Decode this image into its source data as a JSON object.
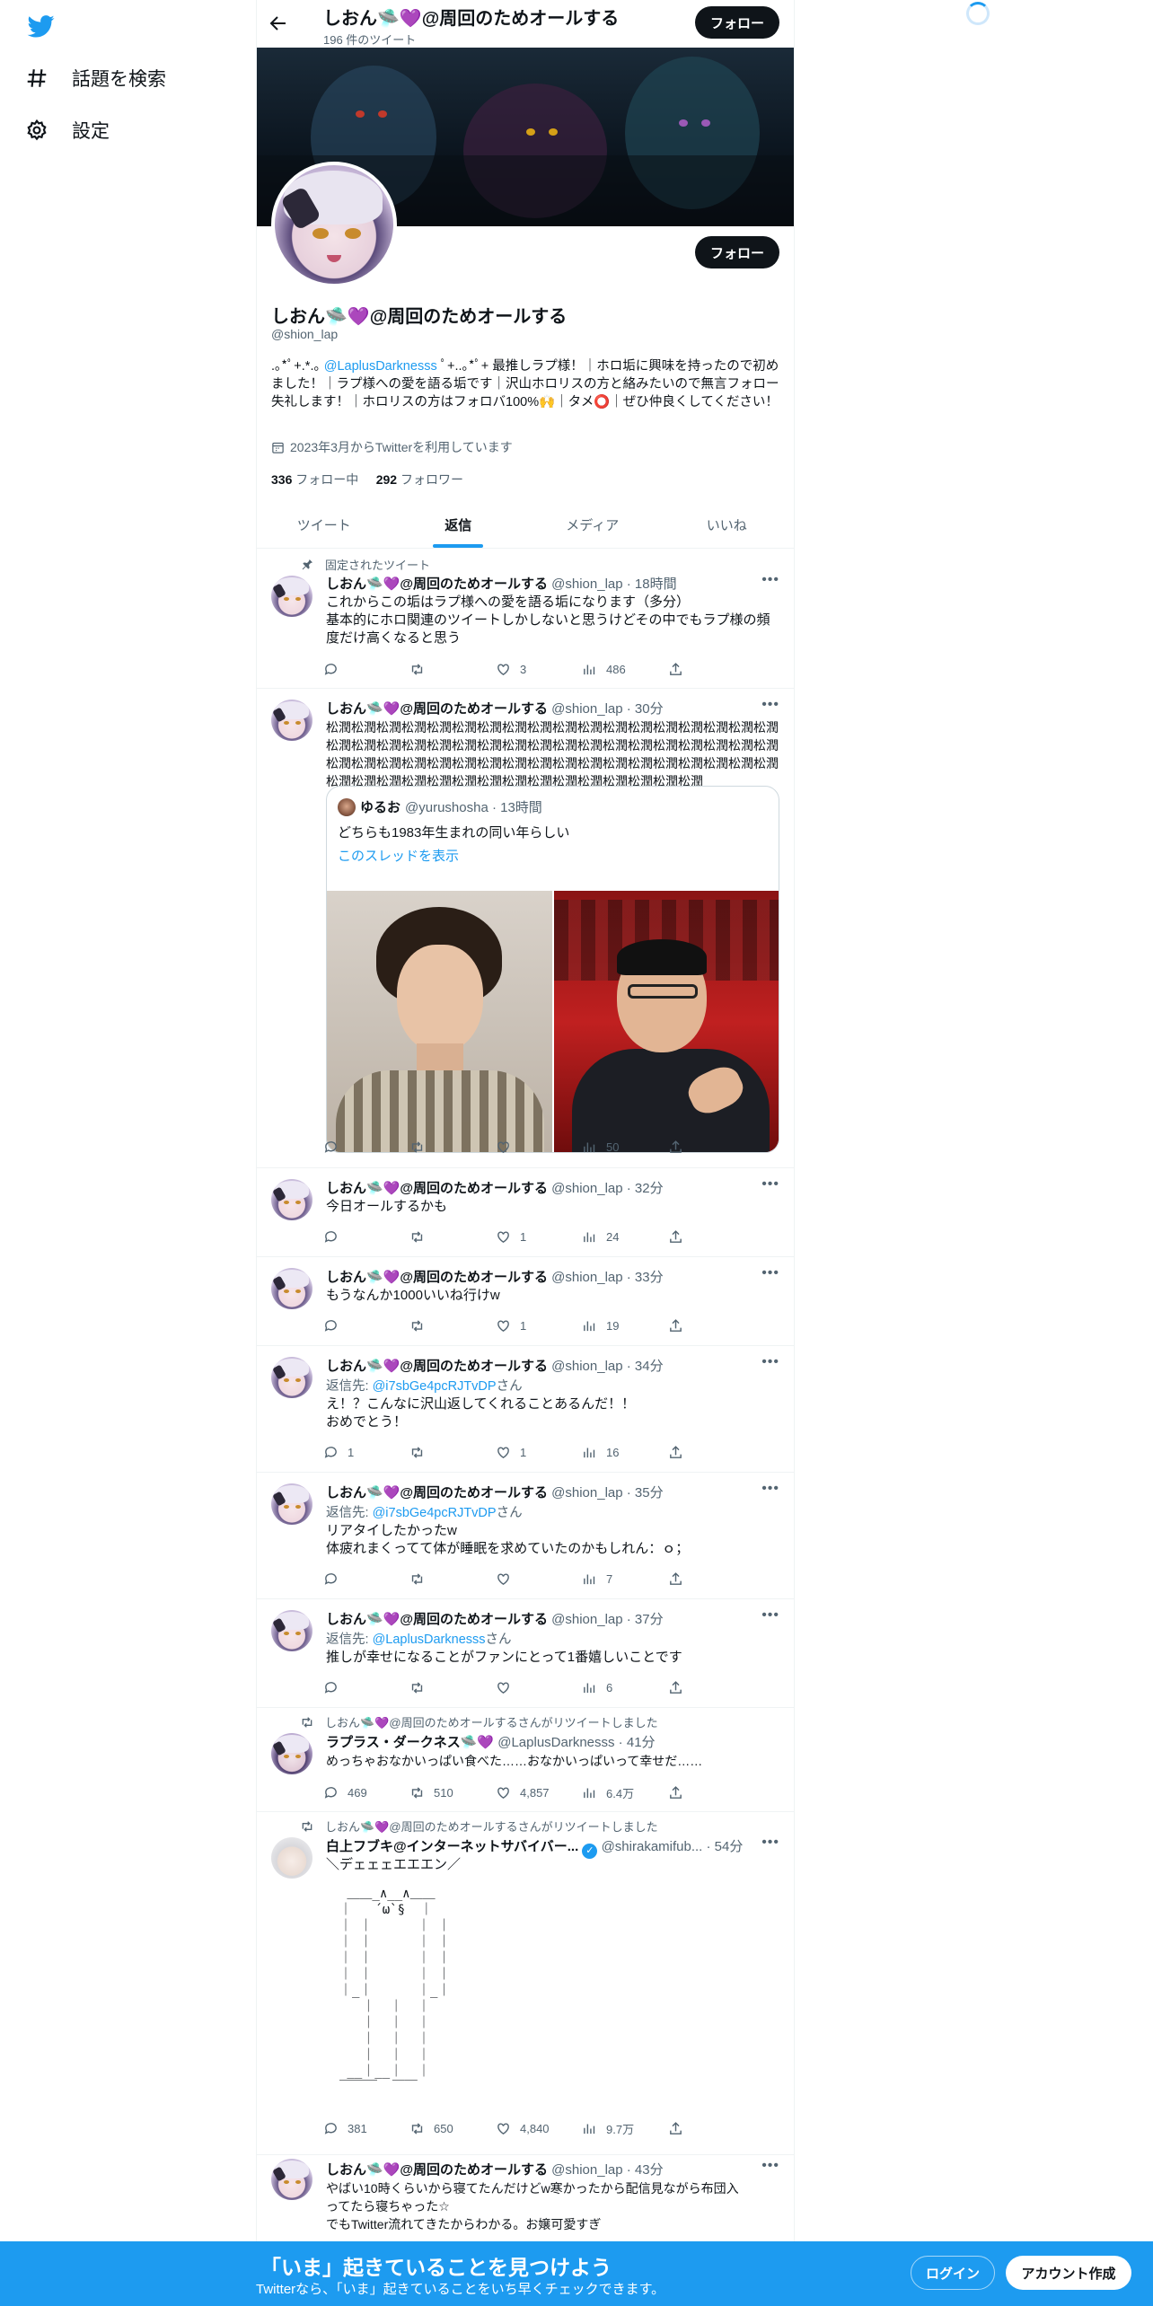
{
  "nav": {
    "logo": "twitter-bird-icon",
    "items": [
      {
        "label": "話題を検索",
        "icon": "hashtag-icon"
      },
      {
        "label": "設定",
        "icon": "gear-icon"
      }
    ]
  },
  "header": {
    "name": "しおん🛸💜@周回のためオールする",
    "tweet_count": "196 件のツイート",
    "follow_label": "フォロー"
  },
  "profile": {
    "name": "しおん🛸💜@周回のためオールする",
    "handle": "@shion_lap",
    "follow_label": "フォロー",
    "bio_pre": ".｡*ﾟ+.*.｡ ",
    "bio_mention": "@LaplusDarknesss",
    "bio_rest": " ﾟ+..｡*ﾟ+ 最推しラプ様！｜ホロ垢に興味を持ったので初めました！｜ラプ様への愛を語る垢です｜沢山ホロリスの方と絡みたいので無言フォロー失礼します！｜ホロリスの方はフォロバ100%🙌｜タメ⭕️｜ぜひ仲良くしてください！",
    "joined": "2023年3月からTwitterを利用しています",
    "following_count": "336",
    "following_label": "フォロー中",
    "followers_count": "292",
    "followers_label": "フォロワー"
  },
  "tabs": [
    {
      "label": "ツイート",
      "active": false
    },
    {
      "label": "返信",
      "active": true
    },
    {
      "label": "メディア",
      "active": false
    },
    {
      "label": "いいね",
      "active": false
    }
  ],
  "tweets": [
    {
      "context": "固定されたツイート",
      "name": "しおん🛸💜@周回のためオールする",
      "handle_time": "@shion_lap · 18時間",
      "text_lines": [
        "これからこの垢はラプ様への愛を語る垢になります（多分）",
        "基本的にホロ関連のツイートしかしないと思うけどその中でもラプ様の頻",
        "度だけ高くなると思う"
      ],
      "replies": "",
      "retweets": "",
      "likes": "3",
      "views": "486"
    },
    {
      "name": "しおん🛸💜@周回のためオールする",
      "handle_time": "@shion_lap · 30分",
      "text_lines": [
        "松潤松潤松潤松潤松潤松潤松潤松潤松潤松潤松潤松潤松潤松潤松潤松潤松潤松潤",
        "松潤松潤松潤松潤松潤松潤松潤松潤松潤松潤松潤松潤松潤松潤松潤松潤松潤松潤",
        "松潤松潤松潤松潤松潤松潤松潤松潤松潤松潤松潤松潤松潤松潤松潤松潤松潤松潤",
        "松潤松潤松潤松潤松潤松潤松潤松潤松潤松潤松潤松潤松潤松潤松潤"
      ],
      "quote": {
        "name": "ゆるお",
        "handle_time": "@yurushosha · 13時間",
        "text": "どちらも1983年生まれの同い年らしい",
        "thread_link": "このスレッドを表示"
      },
      "replies": "",
      "retweets": "",
      "likes": "",
      "views": "50"
    },
    {
      "name": "しおん🛸💜@周回のためオールする",
      "handle_time": "@shion_lap · 32分",
      "text_lines": [
        "今日オールするかも"
      ],
      "replies": "",
      "retweets": "",
      "likes": "1",
      "views": "24"
    },
    {
      "name": "しおん🛸💜@周回のためオールする",
      "handle_time": "@shion_lap · 33分",
      "text_lines": [
        "もうなんか1000いいね行けw"
      ],
      "replies": "",
      "retweets": "",
      "likes": "1",
      "views": "19"
    },
    {
      "name": "しおん🛸💜@周回のためオールする",
      "handle_time": "@shion_lap · 34分",
      "reply_prefix": "返信先: ",
      "reply_to": "@i7sbGe4pcRJTvDP",
      "reply_suffix": "さん",
      "text_lines": [
        "え！？こんなに沢山返してくれることあるんだ！！",
        "おめでとう！"
      ],
      "replies": "1",
      "retweets": "",
      "likes": "1",
      "views": "16"
    },
    {
      "name": "しおん🛸💜@周回のためオールする",
      "handle_time": "@shion_lap · 35分",
      "reply_prefix": "返信先: ",
      "reply_to": "@i7sbGe4pcRJTvDP",
      "reply_suffix": "さん",
      "text_lines": [
        "リアタイしたかったw",
        "体疲れまくってて体が睡眠を求めていたのかもしれん：ｏ；"
      ],
      "replies": "",
      "retweets": "",
      "likes": "",
      "views": "7"
    },
    {
      "name": "しおん🛸💜@周回のためオールする",
      "handle_time": "@shion_lap · 37分",
      "reply_prefix": "返信先: ",
      "reply_to": "@LaplusDarknesss",
      "reply_suffix": "さん",
      "text_lines": [
        "推しが幸せになることがファンにとって1番嬉しいことです"
      ],
      "replies": "",
      "retweets": "",
      "likes": "",
      "views": "6"
    },
    {
      "context": "しおん🛸💜@周回のためオールするさんがリツイートしました",
      "name": "ラプラス・ダークネス🛸💜",
      "handle_time": "@LaplusDarknesss · 41分",
      "text_lines": [
        "めっちゃおなかいっぱい食べた……おなかいっぱいって幸せだ……"
      ],
      "replies": "469",
      "retweets": "510",
      "likes": "4,857",
      "views": "6.4万"
    },
    {
      "context": "しおん🛸💜@周回のためオールするさんがリツイートしました",
      "name": "白上フブキ@インターネットサバイバー...",
      "handle_time": "@shirakamifub... · 54分",
      "text_lines": [
        "＼デェェェエエエン／"
      ],
      "ascii": " ＿＿_∧__∧＿＿\n｜   ´ω`§  ｜\n｜ ｜      ｜ ｜\n｜ ｜      ｜ ｜\n｜ ｜      ｜ ｜\n｜ ｜      ｜ ｜\n｜_｜      ｜_｜\n   ｜  ｜  ｜\n   ｜  ｜  ｜\n   ｜  ｜  ｜\n   ｜  ｜  ｜\n __｜__｜  ｜\n￣￣￣  ￣￣",
      "replies": "381",
      "retweets": "650",
      "likes": "4,840",
      "views": "9.7万"
    },
    {
      "name": "しおん🛸💜@周回のためオールする",
      "handle_time": "@shion_lap · 43分",
      "text_lines": [
        "やばい10時くらいから寝てたんだけどw寒かったから配信見ながら布団入",
        "ってたら寝ちゃった☆",
        "でもTwitter流れてきたからわかる。お嬢可愛すぎ"
      ]
    }
  ],
  "bottom_bar": {
    "title": "「いま」起きていることを見つけよう",
    "subtitle": "Twitterなら、「いま」起きていることをいち早くチェックできます。",
    "login": "ログイン",
    "signup": "アカウント作成"
  },
  "colors": {
    "accent": "#1d9bf0",
    "text": "#0f1419",
    "secondary": "#536471"
  }
}
